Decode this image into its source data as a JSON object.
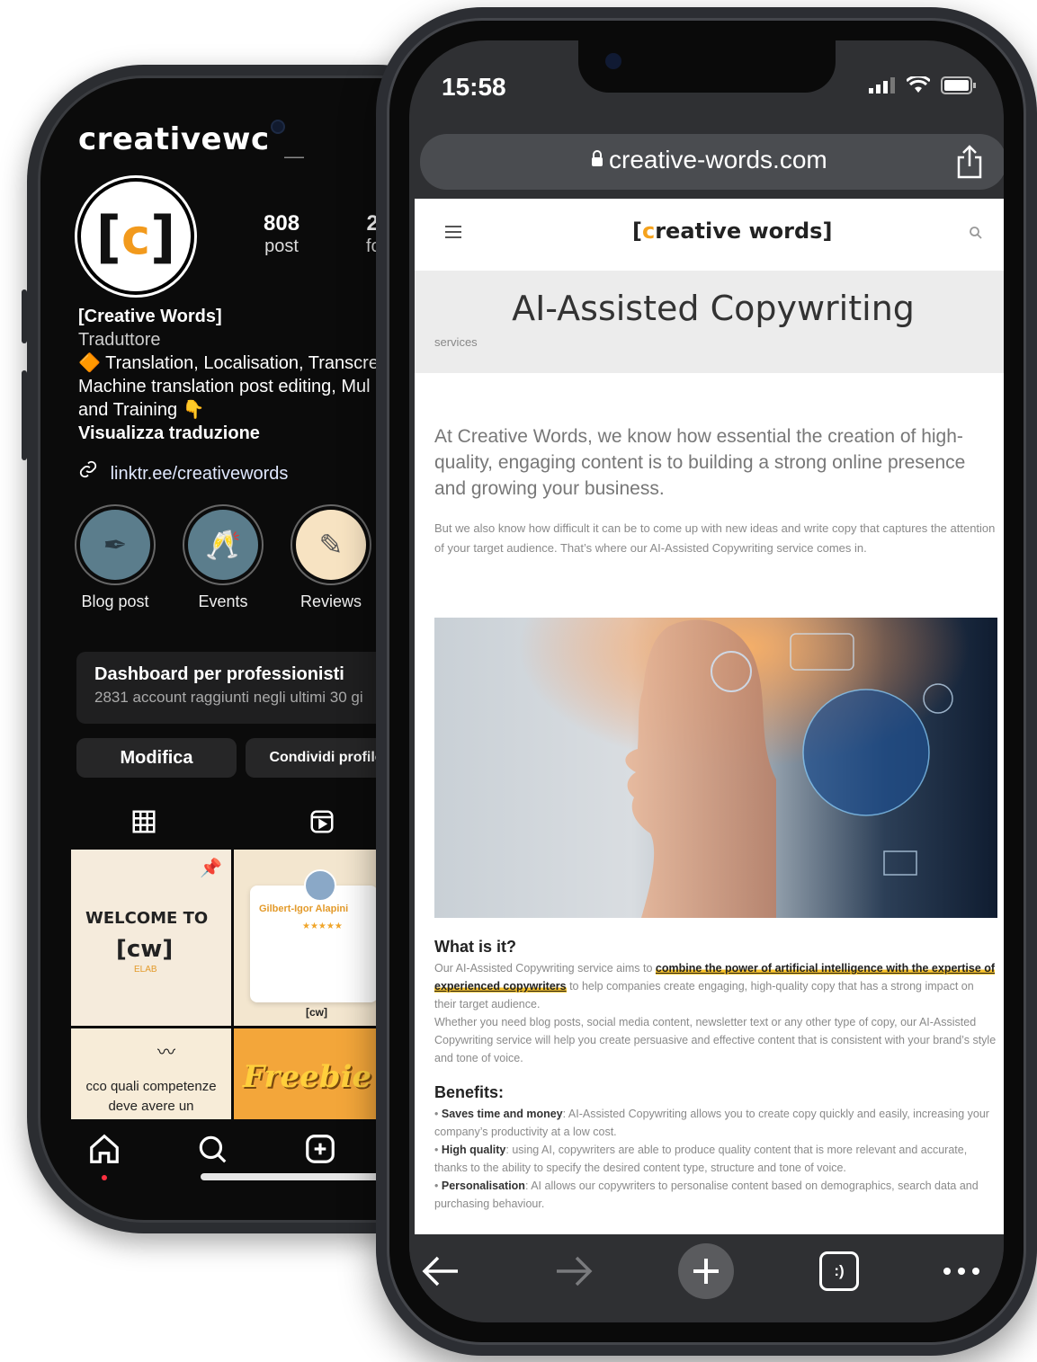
{
  "instagram": {
    "username": "creativewс",
    "header_dash": "—",
    "stats": [
      {
        "value": "808",
        "label": "post"
      },
      {
        "value": "2.",
        "label": "fol"
      }
    ],
    "bio": {
      "name": "[Creative Words]",
      "category": "Traduttore",
      "line1": "🔶 Translation, Localisation, Transcre",
      "line2": "Machine translation post editing, Mul",
      "line3": "and Training 👇",
      "translate": "Visualizza traduzione"
    },
    "link": "linktr.ee/creativewords",
    "highlights": [
      {
        "label": "Blog post",
        "icon": "pen-nib-icon"
      },
      {
        "label": "Events",
        "icon": "cheers-glasses-icon"
      },
      {
        "label": "Reviews",
        "icon": "review-bubble-icon"
      }
    ],
    "dashboard": {
      "title": "Dashboard per professionisti",
      "subtitle": "2831 account raggiunti negli ultimi 30 gi"
    },
    "buttons": {
      "edit": "Modifica",
      "share": "Condividi profilo"
    },
    "grid": {
      "post1_title": "WELCOME TO",
      "post1_logo": "[cw]",
      "post1_sub": "ELAB",
      "post2_name": "Gilbert-Igor Alapini",
      "post2_stars": "★★★★★",
      "post2_logo": "[cw]",
      "post3_text": "cco quali competenze deve avere un",
      "post4_text": "Freebie"
    }
  },
  "browser": {
    "time": "15:58",
    "url": "creative-words.com",
    "page": {
      "logo_bracket_open": "[",
      "logo_c": "c",
      "logo_rest": "reative words]",
      "title": "AI-Assisted Copywriting",
      "breadcrumb": "services",
      "lead": "At Creative Words, we know how essential the creation of high-quality, engaging content is to building a strong online presence and growing your business.",
      "intro": "But we also know how difficult it can be to come up with new ideas and write copy that captures the attention of your target audience. That’s where our AI-Assisted Copywriting service comes in.",
      "what_heading": "What is it?",
      "what_p1_start": "Our AI-Assisted Copywriting service aims to ",
      "what_p1_highlight": "combine the power of artificial intelligence with the expertise of experienced copywriters",
      "what_p1_end": " to help companies create engaging, high-quality copy that has a strong impact on their target audience.",
      "what_p2": "Whether you need blog posts, social media content, newsletter text or any other type of copy, our AI-Assisted Copywriting service will help you create persuasive and effective content that is consistent with your brand’s style and tone of voice.",
      "benefits_heading": "Benefits:",
      "benefits": [
        {
          "title": "Saves time and money",
          "text": ": AI-Assisted Copywriting allows you to create copy quickly and easily, increasing your company’s productivity at a low cost."
        },
        {
          "title": "High quality",
          "text": ": using AI, copywriters are able to produce quality content that is more relevant and accurate, thanks to the ability to specify the desired content type, structure and tone of voice."
        },
        {
          "title": "Personalisation",
          "text": ": AI allows our copywriters to personalise content based on demographics, search data and purchasing behaviour."
        }
      ]
    },
    "toolbar": {
      "tabs_glyph": ":)"
    }
  },
  "colors": {
    "brand_orange": "#f5a21d",
    "highlight_yellow": "#f5c02a",
    "ig_background": "#0b0b0b",
    "browser_chrome": "#2f3033"
  }
}
